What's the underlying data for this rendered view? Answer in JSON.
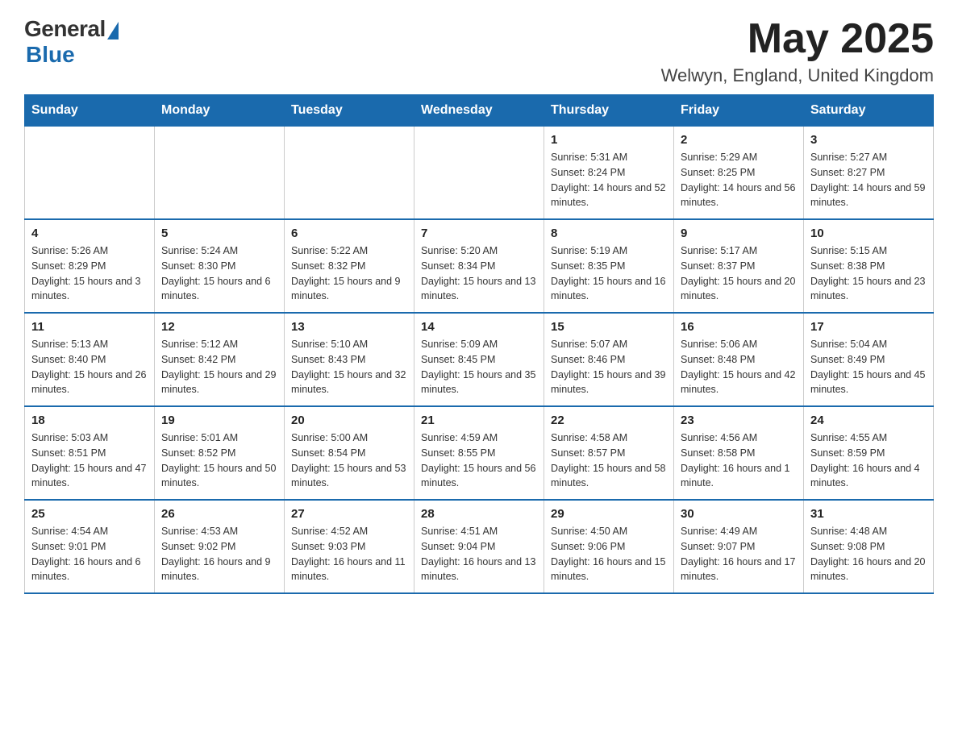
{
  "logo": {
    "general": "General",
    "blue": "Blue"
  },
  "header": {
    "title": "May 2025",
    "subtitle": "Welwyn, England, United Kingdom"
  },
  "calendar": {
    "days_of_week": [
      "Sunday",
      "Monday",
      "Tuesday",
      "Wednesday",
      "Thursday",
      "Friday",
      "Saturday"
    ],
    "weeks": [
      [
        {
          "day": "",
          "info": ""
        },
        {
          "day": "",
          "info": ""
        },
        {
          "day": "",
          "info": ""
        },
        {
          "day": "",
          "info": ""
        },
        {
          "day": "1",
          "info": "Sunrise: 5:31 AM\nSunset: 8:24 PM\nDaylight: 14 hours and 52 minutes."
        },
        {
          "day": "2",
          "info": "Sunrise: 5:29 AM\nSunset: 8:25 PM\nDaylight: 14 hours and 56 minutes."
        },
        {
          "day": "3",
          "info": "Sunrise: 5:27 AM\nSunset: 8:27 PM\nDaylight: 14 hours and 59 minutes."
        }
      ],
      [
        {
          "day": "4",
          "info": "Sunrise: 5:26 AM\nSunset: 8:29 PM\nDaylight: 15 hours and 3 minutes."
        },
        {
          "day": "5",
          "info": "Sunrise: 5:24 AM\nSunset: 8:30 PM\nDaylight: 15 hours and 6 minutes."
        },
        {
          "day": "6",
          "info": "Sunrise: 5:22 AM\nSunset: 8:32 PM\nDaylight: 15 hours and 9 minutes."
        },
        {
          "day": "7",
          "info": "Sunrise: 5:20 AM\nSunset: 8:34 PM\nDaylight: 15 hours and 13 minutes."
        },
        {
          "day": "8",
          "info": "Sunrise: 5:19 AM\nSunset: 8:35 PM\nDaylight: 15 hours and 16 minutes."
        },
        {
          "day": "9",
          "info": "Sunrise: 5:17 AM\nSunset: 8:37 PM\nDaylight: 15 hours and 20 minutes."
        },
        {
          "day": "10",
          "info": "Sunrise: 5:15 AM\nSunset: 8:38 PM\nDaylight: 15 hours and 23 minutes."
        }
      ],
      [
        {
          "day": "11",
          "info": "Sunrise: 5:13 AM\nSunset: 8:40 PM\nDaylight: 15 hours and 26 minutes."
        },
        {
          "day": "12",
          "info": "Sunrise: 5:12 AM\nSunset: 8:42 PM\nDaylight: 15 hours and 29 minutes."
        },
        {
          "day": "13",
          "info": "Sunrise: 5:10 AM\nSunset: 8:43 PM\nDaylight: 15 hours and 32 minutes."
        },
        {
          "day": "14",
          "info": "Sunrise: 5:09 AM\nSunset: 8:45 PM\nDaylight: 15 hours and 35 minutes."
        },
        {
          "day": "15",
          "info": "Sunrise: 5:07 AM\nSunset: 8:46 PM\nDaylight: 15 hours and 39 minutes."
        },
        {
          "day": "16",
          "info": "Sunrise: 5:06 AM\nSunset: 8:48 PM\nDaylight: 15 hours and 42 minutes."
        },
        {
          "day": "17",
          "info": "Sunrise: 5:04 AM\nSunset: 8:49 PM\nDaylight: 15 hours and 45 minutes."
        }
      ],
      [
        {
          "day": "18",
          "info": "Sunrise: 5:03 AM\nSunset: 8:51 PM\nDaylight: 15 hours and 47 minutes."
        },
        {
          "day": "19",
          "info": "Sunrise: 5:01 AM\nSunset: 8:52 PM\nDaylight: 15 hours and 50 minutes."
        },
        {
          "day": "20",
          "info": "Sunrise: 5:00 AM\nSunset: 8:54 PM\nDaylight: 15 hours and 53 minutes."
        },
        {
          "day": "21",
          "info": "Sunrise: 4:59 AM\nSunset: 8:55 PM\nDaylight: 15 hours and 56 minutes."
        },
        {
          "day": "22",
          "info": "Sunrise: 4:58 AM\nSunset: 8:57 PM\nDaylight: 15 hours and 58 minutes."
        },
        {
          "day": "23",
          "info": "Sunrise: 4:56 AM\nSunset: 8:58 PM\nDaylight: 16 hours and 1 minute."
        },
        {
          "day": "24",
          "info": "Sunrise: 4:55 AM\nSunset: 8:59 PM\nDaylight: 16 hours and 4 minutes."
        }
      ],
      [
        {
          "day": "25",
          "info": "Sunrise: 4:54 AM\nSunset: 9:01 PM\nDaylight: 16 hours and 6 minutes."
        },
        {
          "day": "26",
          "info": "Sunrise: 4:53 AM\nSunset: 9:02 PM\nDaylight: 16 hours and 9 minutes."
        },
        {
          "day": "27",
          "info": "Sunrise: 4:52 AM\nSunset: 9:03 PM\nDaylight: 16 hours and 11 minutes."
        },
        {
          "day": "28",
          "info": "Sunrise: 4:51 AM\nSunset: 9:04 PM\nDaylight: 16 hours and 13 minutes."
        },
        {
          "day": "29",
          "info": "Sunrise: 4:50 AM\nSunset: 9:06 PM\nDaylight: 16 hours and 15 minutes."
        },
        {
          "day": "30",
          "info": "Sunrise: 4:49 AM\nSunset: 9:07 PM\nDaylight: 16 hours and 17 minutes."
        },
        {
          "day": "31",
          "info": "Sunrise: 4:48 AM\nSunset: 9:08 PM\nDaylight: 16 hours and 20 minutes."
        }
      ]
    ]
  }
}
